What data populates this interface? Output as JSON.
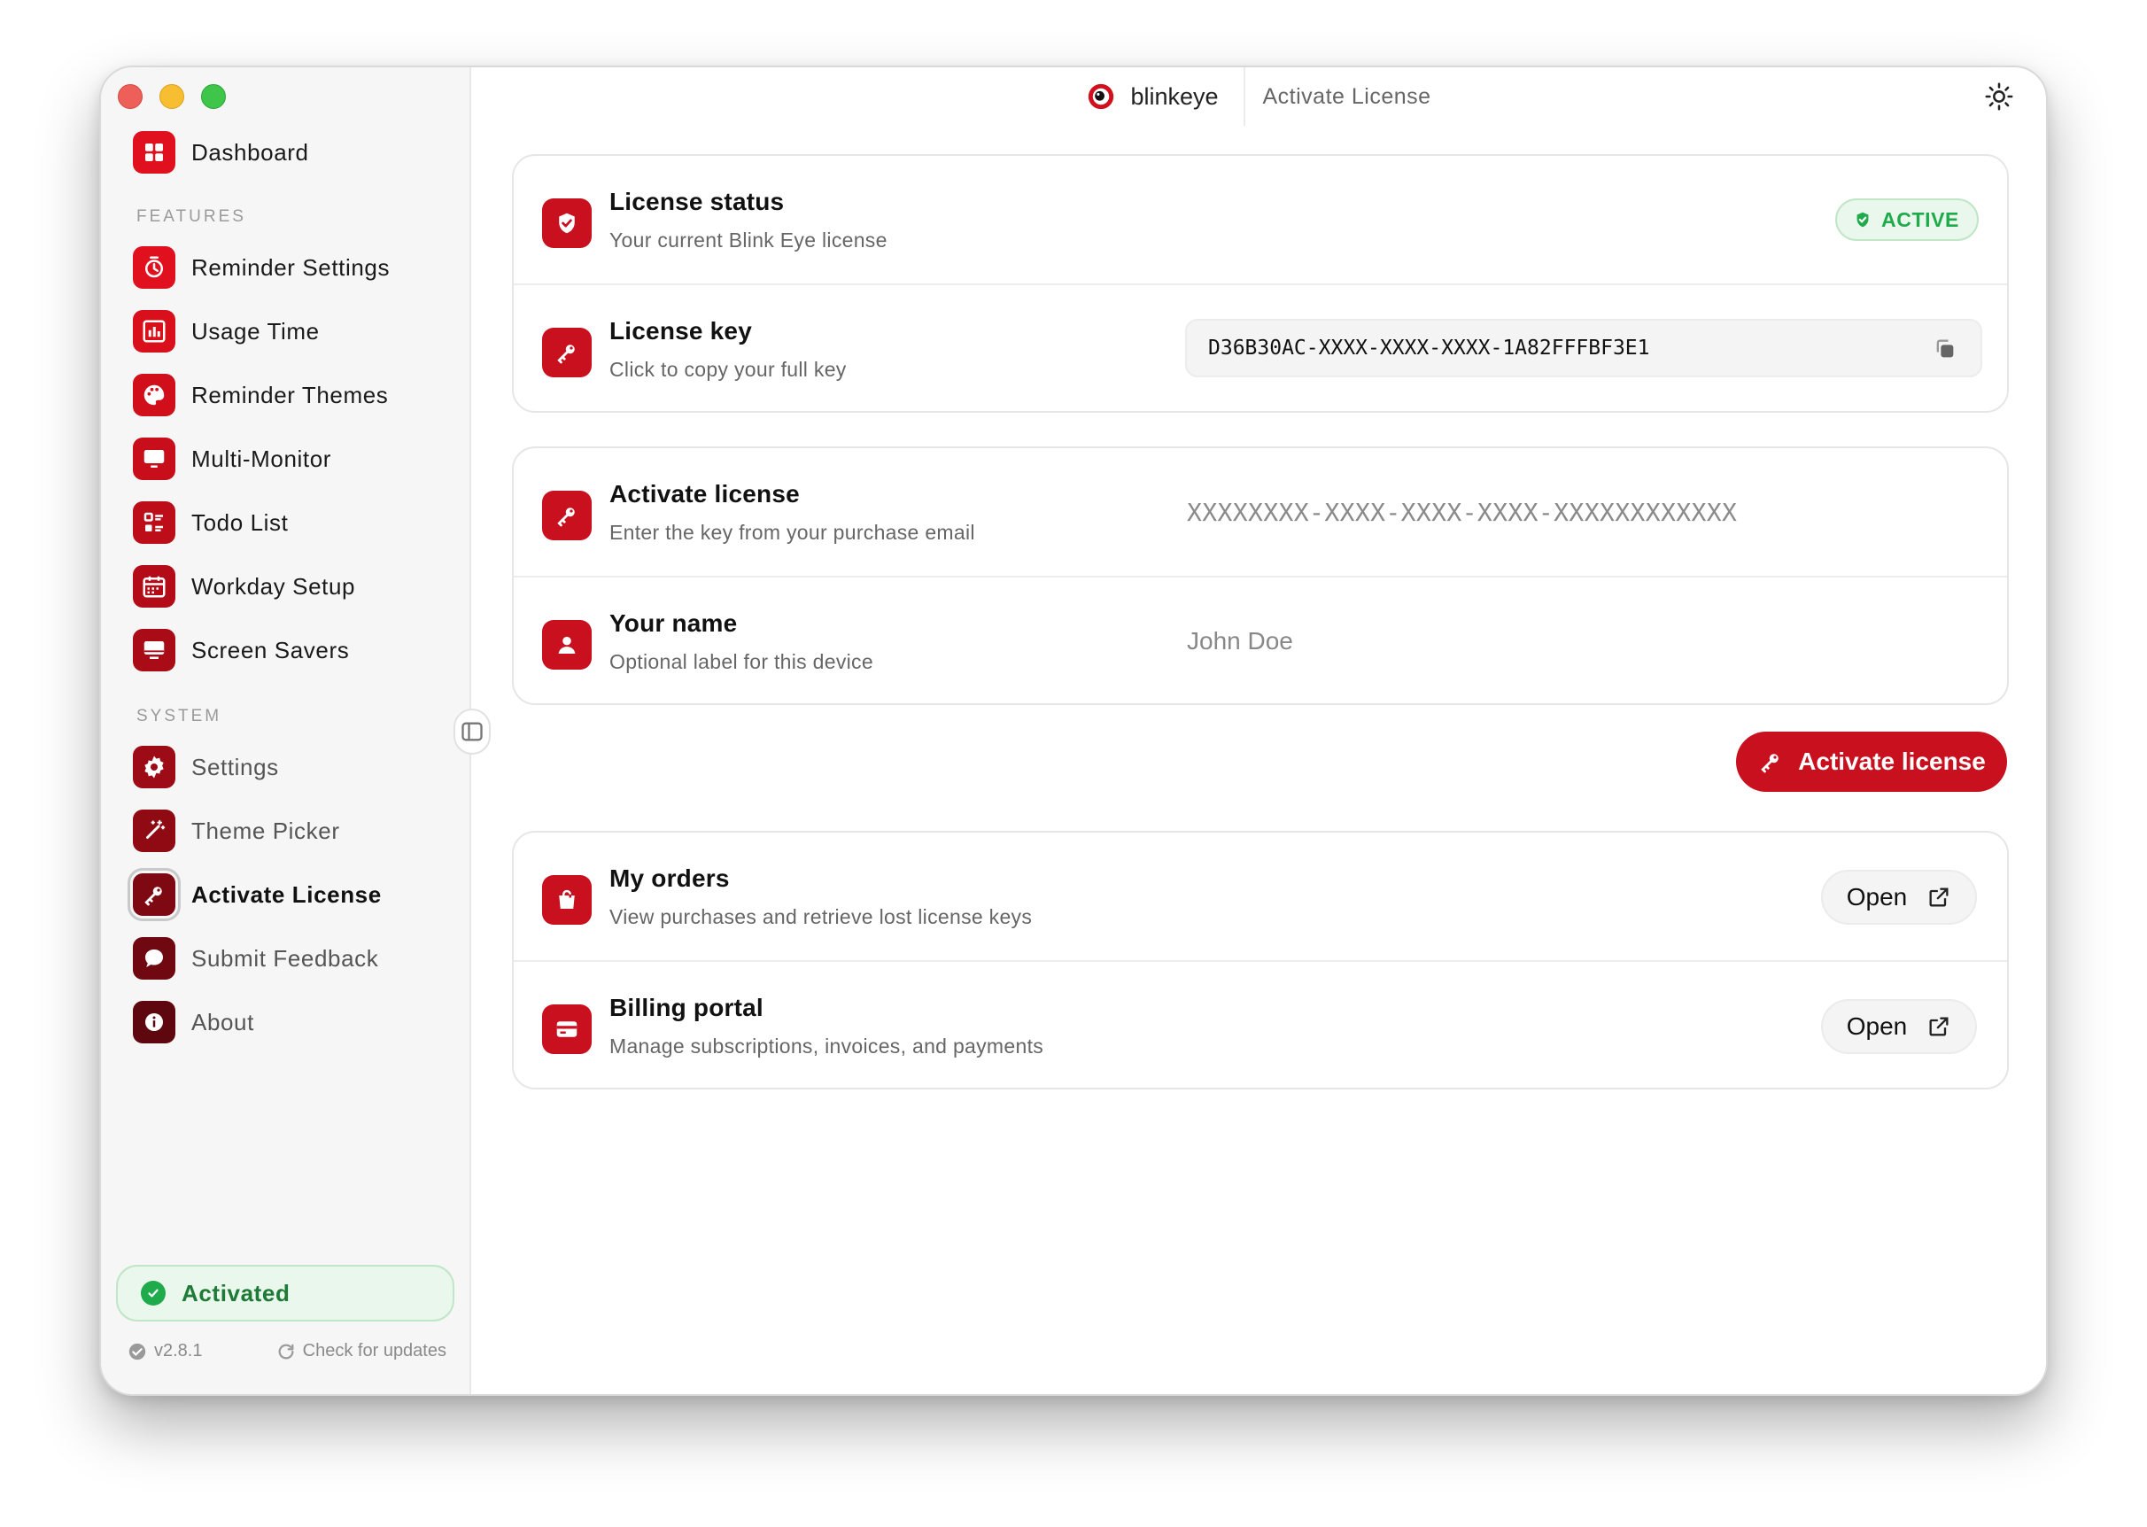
{
  "app": {
    "name": "blinkeye",
    "page_title": "Activate License"
  },
  "sidebar": {
    "dashboard": {
      "label": "Dashboard",
      "icon": "grid-icon"
    },
    "features_heading": "FEATURES",
    "features": [
      {
        "label": "Reminder Settings",
        "icon": "timer-icon"
      },
      {
        "label": "Usage Time",
        "icon": "bar-chart-icon"
      },
      {
        "label": "Reminder Themes",
        "icon": "palette-icon"
      },
      {
        "label": "Multi-Monitor",
        "icon": "monitor-icon"
      },
      {
        "label": "Todo List",
        "icon": "checklist-icon"
      },
      {
        "label": "Workday Setup",
        "icon": "calendar-icon"
      },
      {
        "label": "Screen Savers",
        "icon": "desktop-icon"
      }
    ],
    "system_heading": "SYSTEM",
    "system": [
      {
        "label": "Settings",
        "icon": "gear-icon"
      },
      {
        "label": "Theme Picker",
        "icon": "magic-wand-icon"
      },
      {
        "label": "Activate License",
        "icon": "key-icon",
        "active": true
      },
      {
        "label": "Submit Feedback",
        "icon": "chat-bubble-icon"
      },
      {
        "label": "About",
        "icon": "info-icon"
      }
    ],
    "status": "Activated",
    "version": "v2.8.1",
    "check_updates": "Check for updates"
  },
  "license_status": {
    "title": "License status",
    "subtitle": "Your current Blink Eye license",
    "badge": "ACTIVE"
  },
  "license_key": {
    "title": "License key",
    "subtitle": "Click to copy your full key",
    "value": "D36B30AC-XXXX-XXXX-XXXX-1A82FFFBF3E1"
  },
  "activate": {
    "title": "Activate license",
    "subtitle": "Enter the key from your purchase email",
    "placeholder": "XXXXXXXX-XXXX-XXXX-XXXX-XXXXXXXXXXXX"
  },
  "your_name": {
    "title": "Your name",
    "subtitle": "Optional label for this device",
    "placeholder": "John Doe"
  },
  "activate_button": "Activate license",
  "orders": {
    "title": "My orders",
    "subtitle": "View purchases and retrieve lost license keys",
    "button": "Open"
  },
  "billing": {
    "title": "Billing portal",
    "subtitle": "Manage subscriptions, invoices, and payments",
    "button": "Open"
  },
  "colors": {
    "brand_red": "#c8101e",
    "success_green": "#1faa4b",
    "sidebar_bg": "#f6f6f6"
  }
}
